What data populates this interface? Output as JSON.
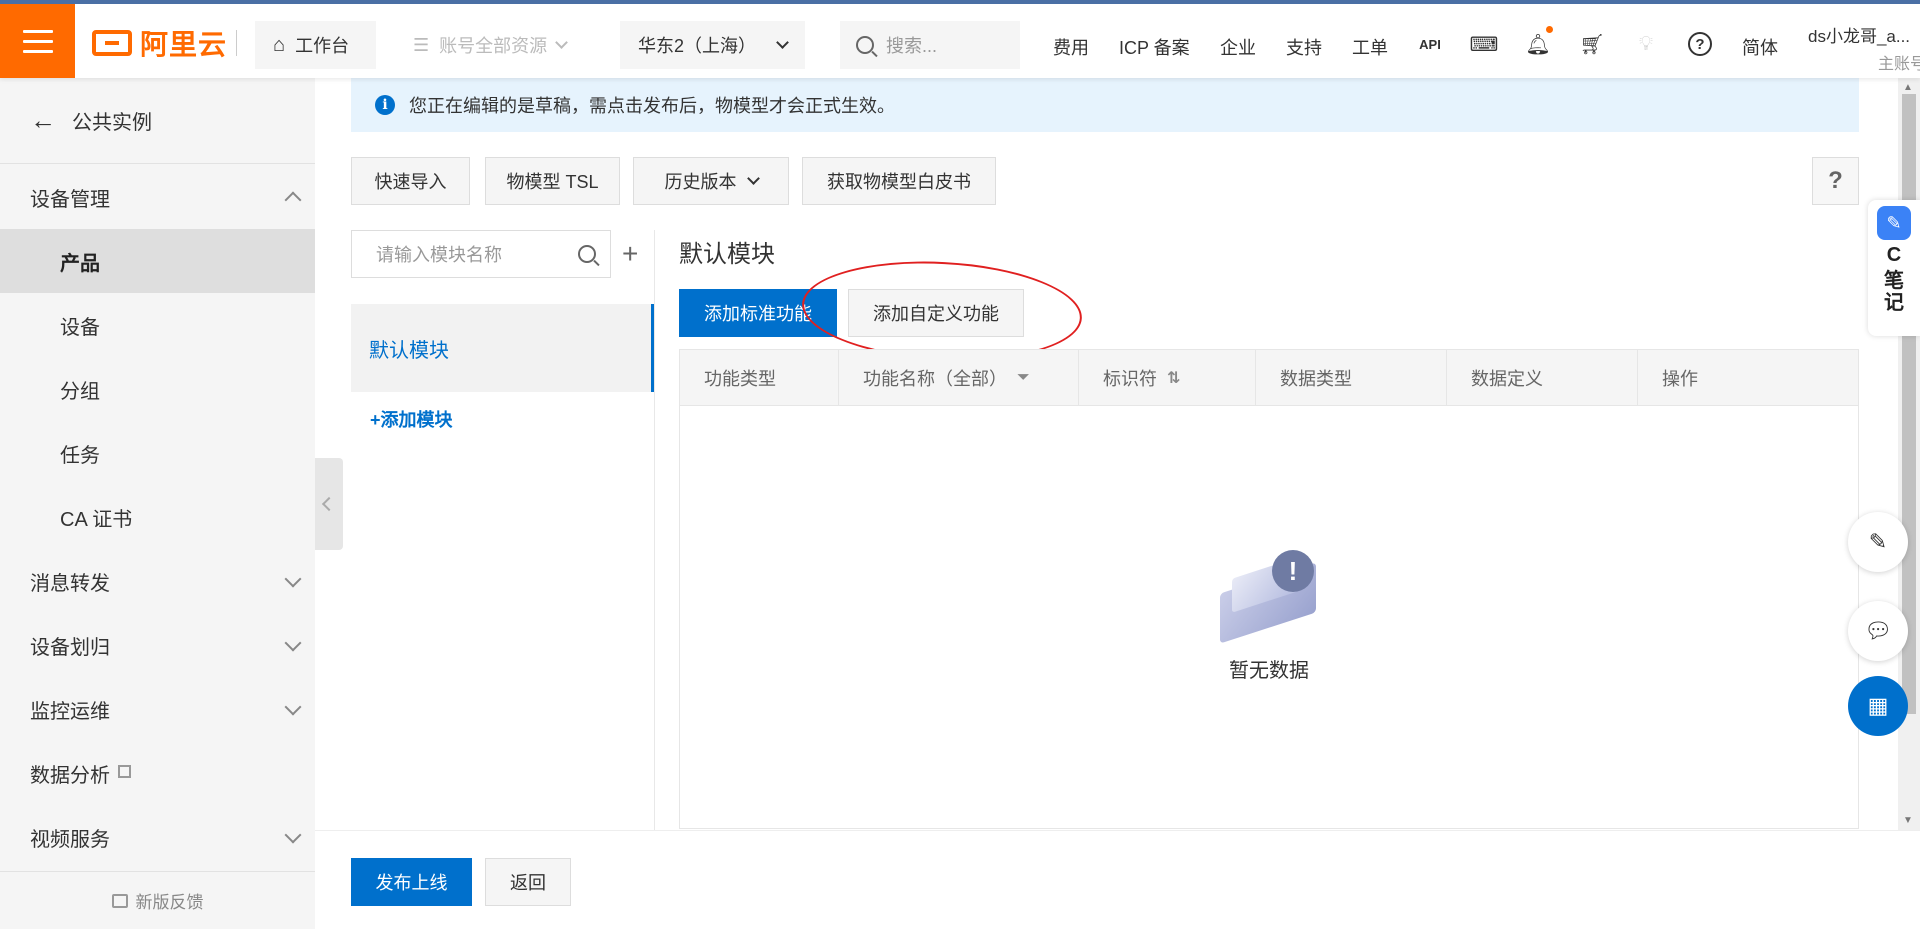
{
  "topbar": {
    "logo_text": "阿里云",
    "workbench": "工作台",
    "resources": "账号全部资源",
    "region": "华东2（上海）",
    "search_placeholder": "搜索...",
    "links": [
      "费用",
      "ICP 备案",
      "企业",
      "支持",
      "工单"
    ],
    "lang": "简体",
    "user_name": "ds小龙哥_a...",
    "user_sub": "主账号"
  },
  "sidebar": {
    "back_label": "公共实例",
    "device_mgmt": "设备管理",
    "items": [
      "产品",
      "设备",
      "分组",
      "任务",
      "CA 证书"
    ],
    "groups": [
      "消息转发",
      "设备划归",
      "监控运维",
      "数据分析",
      "视频服务"
    ],
    "feedback": "新版反馈"
  },
  "notice": {
    "text": "您正在编辑的是草稿，需点击发布后，物模型才会正式生效。"
  },
  "toolbar": {
    "quick_import": "快速导入",
    "tsl": "物模型 TSL",
    "history": "历史版本",
    "whitepaper": "获取物模型白皮书",
    "help": "?"
  },
  "modules": {
    "search_placeholder": "请输入模块名称",
    "plus": "+",
    "selected": "默认模块",
    "add_module": "+添加模块"
  },
  "main": {
    "title": "默认模块",
    "add_standard": "添加标准功能",
    "add_custom": "添加自定义功能",
    "columns": [
      "功能类型",
      "功能名称（全部）",
      "标识符",
      "数据类型",
      "数据定义",
      "操作"
    ],
    "empty_text": "暂无数据"
  },
  "footer": {
    "publish": "发布上线",
    "back": "返回"
  },
  "notes_panel": {
    "letter": "C",
    "label": "笔记"
  }
}
